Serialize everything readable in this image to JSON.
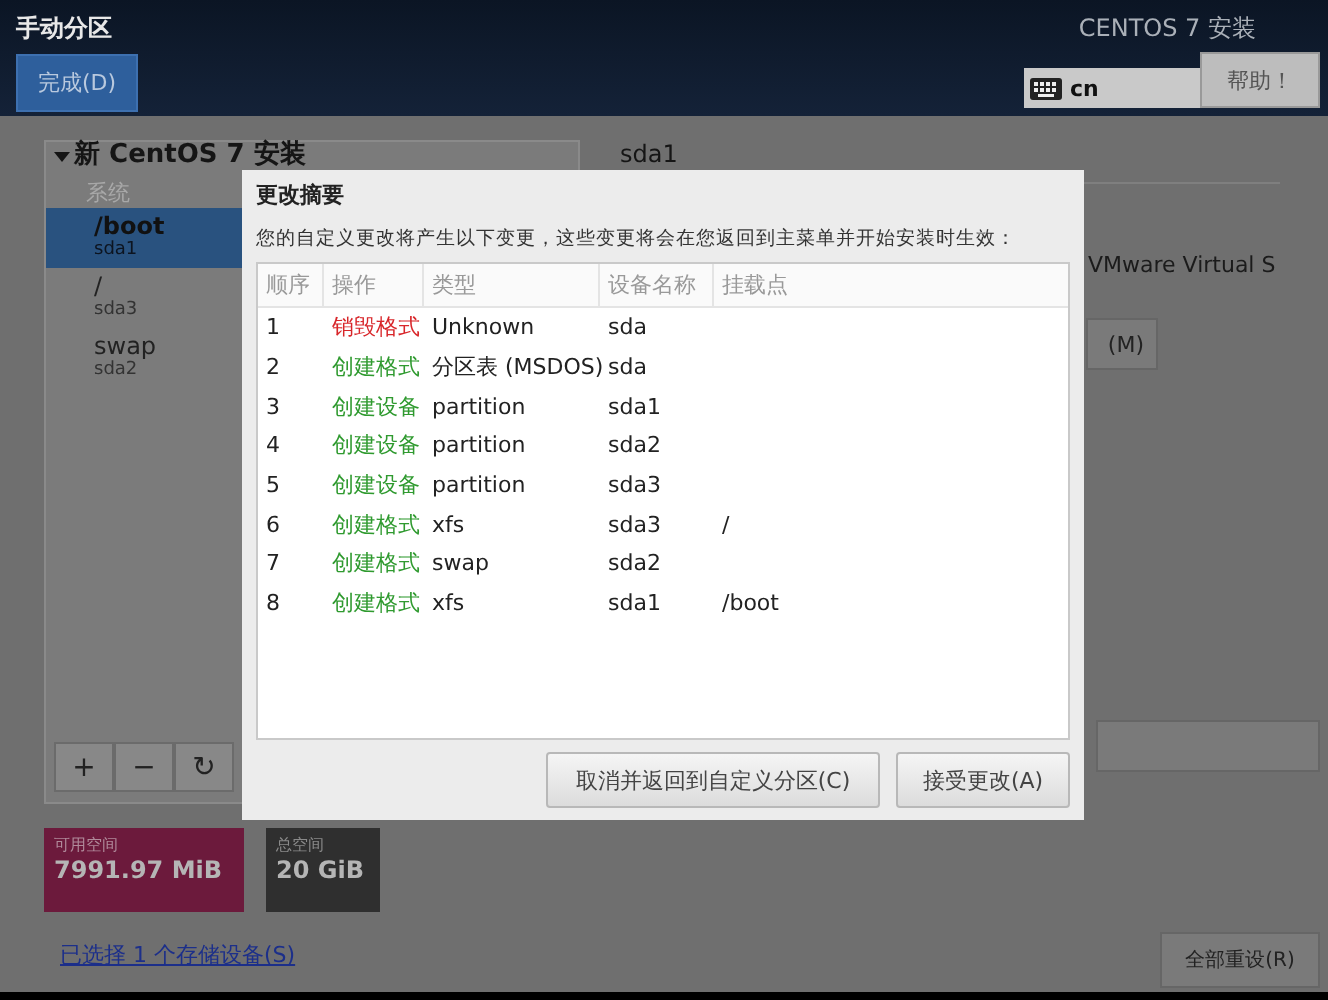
{
  "header": {
    "title": "手动分区",
    "done_button": "完成(D)",
    "product": "CENTOS 7 安装",
    "keyboard": "cn",
    "help_button": "帮助！"
  },
  "tree": {
    "root": "新 CentOS 7 安装",
    "expanded": true,
    "groups": [
      {
        "label": "系统",
        "items": [
          {
            "mount": "/boot",
            "device": "sda1",
            "selected": true
          },
          {
            "mount": "/",
            "device": "sda3",
            "selected": false
          },
          {
            "mount": "swap",
            "device": "sda2",
            "selected": false
          }
        ]
      }
    ]
  },
  "toolbar": [
    "+",
    "−",
    "↻"
  ],
  "space": [
    {
      "label": "可用空间",
      "value": "7991.97 MiB",
      "kind": "free"
    },
    {
      "label": "总空间",
      "value": "20 GiB",
      "kind": "total"
    }
  ],
  "storage_link": "已选择 1 个存储设备(S)",
  "detail": {
    "title": "sda1",
    "device_text": "VMware Virtual S",
    "modify_button": "(M)",
    "reset_button": "全部重设(R)"
  },
  "dialog": {
    "title": "更改摘要",
    "message": "您的自定义更改将产生以下变更，这些变更将会在您返回到主菜单并开始安装时生效：",
    "columns": [
      "顺序",
      "操作",
      "类型",
      "设备名称",
      "挂载点"
    ],
    "rows": [
      {
        "order": "1",
        "action": "销毁格式",
        "kind": "destroy",
        "type": "Unknown",
        "device": "sda",
        "mount": ""
      },
      {
        "order": "2",
        "action": "创建格式",
        "kind": "create",
        "type": "分区表 (MSDOS)",
        "device": "sda",
        "mount": ""
      },
      {
        "order": "3",
        "action": "创建设备",
        "kind": "create",
        "type": "partition",
        "device": "sda1",
        "mount": ""
      },
      {
        "order": "4",
        "action": "创建设备",
        "kind": "create",
        "type": "partition",
        "device": "sda2",
        "mount": ""
      },
      {
        "order": "5",
        "action": "创建设备",
        "kind": "create",
        "type": "partition",
        "device": "sda3",
        "mount": ""
      },
      {
        "order": "6",
        "action": "创建格式",
        "kind": "create",
        "type": "xfs",
        "device": "sda3",
        "mount": "/"
      },
      {
        "order": "7",
        "action": "创建格式",
        "kind": "create",
        "type": "swap",
        "device": "sda2",
        "mount": ""
      },
      {
        "order": "8",
        "action": "创建格式",
        "kind": "create",
        "type": "xfs",
        "device": "sda1",
        "mount": "/boot"
      }
    ],
    "buttons": [
      "取消并返回到自定义分区(C)",
      "接受更改(A)"
    ]
  }
}
